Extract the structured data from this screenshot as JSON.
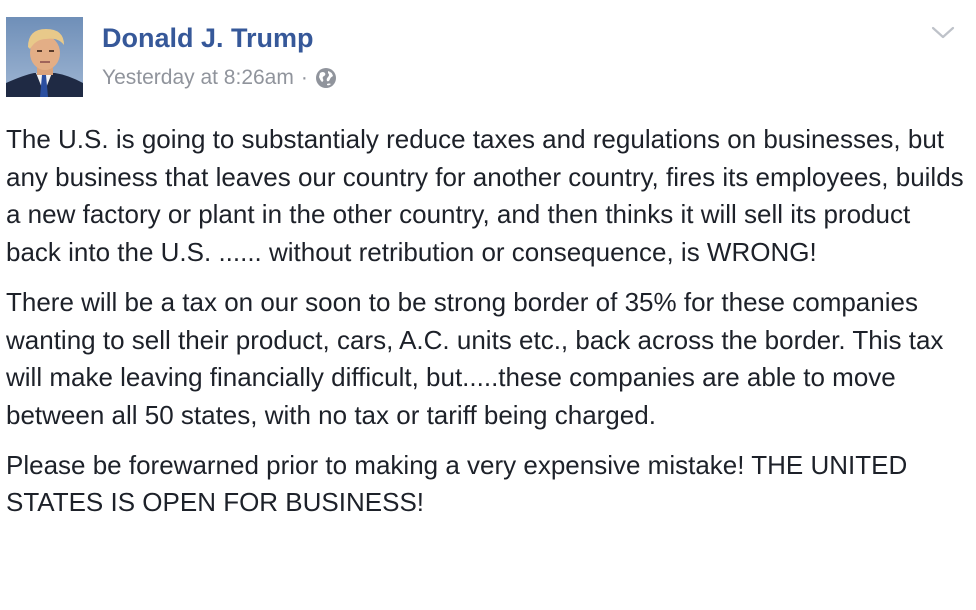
{
  "post": {
    "author": "Donald J. Trump",
    "timestamp": "Yesterday at 8:26am",
    "separator": "·",
    "privacy_icon": "globe-icon",
    "menu_icon": "chevron-down-icon",
    "paragraphs": [
      "The U.S. is going to substantialy reduce taxes and regulations on businesses, but any business that leaves our country for another country, fires its employees, builds a new factory or plant in the other country, and then thinks it will sell its product back into the U.S. ...... without retribution or consequence, is WRONG!",
      "There will be a tax on our soon to be strong border of 35% for these companies wanting to sell their product, cars, A.C. units etc., back across the border. This tax will make leaving financially difficult, but.....these companies are able to move between all 50 states, with no tax or tariff being charged.",
      "Please be forewarned prior to making a very expensive mistake! THE UNITED STATES IS OPEN FOR BUSINESS!"
    ]
  },
  "colors": {
    "author_link": "#365899",
    "meta_text": "#90949c",
    "body_text": "#1d2129"
  }
}
